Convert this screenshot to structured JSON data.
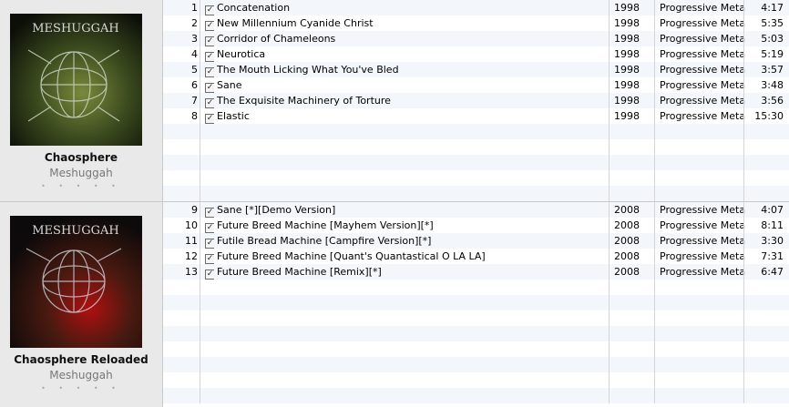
{
  "albums": [
    {
      "title": "Chaosphere",
      "artist": "Meshuggah",
      "cover_logo": "MESHUGGAH",
      "tracks": [
        {
          "num": "1",
          "name": "Concatenation",
          "year": "1998",
          "genre": "Progressive Metal",
          "time": "4:17"
        },
        {
          "num": "2",
          "name": "New Millennium Cyanide Christ",
          "year": "1998",
          "genre": "Progressive Metal",
          "time": "5:35"
        },
        {
          "num": "3",
          "name": "Corridor of Chameleons",
          "year": "1998",
          "genre": "Progressive Metal",
          "time": "5:03"
        },
        {
          "num": "4",
          "name": "Neurotica",
          "year": "1998",
          "genre": "Progressive Metal",
          "time": "5:19"
        },
        {
          "num": "5",
          "name": "The Mouth Licking What You've Bled",
          "year": "1998",
          "genre": "Progressive Metal",
          "time": "3:57"
        },
        {
          "num": "6",
          "name": "Sane",
          "year": "1998",
          "genre": "Progressive Metal",
          "time": "3:48"
        },
        {
          "num": "7",
          "name": "The Exquisite Machinery of Torture",
          "year": "1998",
          "genre": "Progressive Metal",
          "time": "3:56"
        },
        {
          "num": "8",
          "name": "Elastic",
          "year": "1998",
          "genre": "Progressive Metal",
          "time": "15:30"
        }
      ]
    },
    {
      "title": "Chaosphere Reloaded",
      "artist": "Meshuggah",
      "cover_logo": "MESHUGGAH",
      "tracks": [
        {
          "num": "9",
          "name": "Sane [*][Demo Version]",
          "year": "2008",
          "genre": "Progressive Metal",
          "time": "4:07"
        },
        {
          "num": "10",
          "name": "Future Breed Machine [Mayhem Version][*]",
          "year": "2008",
          "genre": "Progressive Metal",
          "time": "8:11"
        },
        {
          "num": "11",
          "name": "Futile Bread Machine [Campfire Version][*]",
          "year": "2008",
          "genre": "Progressive Metal",
          "time": "3:30"
        },
        {
          "num": "12",
          "name": "Future Breed Machine [Quant's Quantastical O LA LA]",
          "year": "2008",
          "genre": "Progressive Metal",
          "time": "7:31"
        },
        {
          "num": "13",
          "name": "Future Breed Machine [Remix][*]",
          "year": "2008",
          "genre": "Progressive Metal",
          "time": "6:47"
        }
      ]
    }
  ],
  "rating_dots": "• • • • •",
  "check_glyph": "✓",
  "colors": {
    "row_alt": "#f3f6fa",
    "album_panel": "#e9e9e9",
    "artist_text": "#777777"
  }
}
